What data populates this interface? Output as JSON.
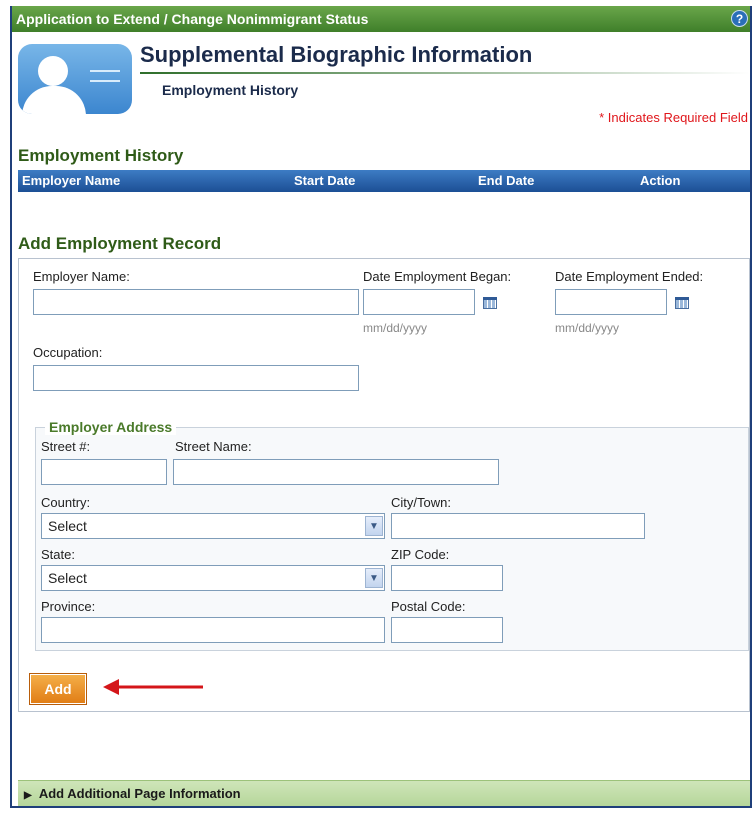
{
  "titlebar": {
    "title": "Application to Extend / Change Nonimmigrant Status",
    "help_glyph": "?"
  },
  "header": {
    "title": "Supplemental Biographic Information",
    "subtitle": "Employment History",
    "required_note": "* Indicates Required Field"
  },
  "history": {
    "heading": "Employment History",
    "columns": [
      "Employer Name",
      "Start Date",
      "End Date",
      "Action"
    ]
  },
  "add_record": {
    "heading": "Add Employment Record",
    "employer_name_label": "Employer Name:",
    "employer_name_value": "",
    "date_began_label": "Date Employment Began:",
    "date_began_value": "",
    "date_began_hint": "mm/dd/yyyy",
    "date_ended_label": "Date Employment Ended:",
    "date_ended_value": "",
    "date_ended_hint": "mm/dd/yyyy",
    "occupation_label": "Occupation:",
    "occupation_value": ""
  },
  "address": {
    "legend": "Employer Address",
    "street_num_label": "Street #:",
    "street_name_label": "Street Name:",
    "country_label": "Country:",
    "country_value": "Select",
    "city_label": "City/Town:",
    "state_label": "State:",
    "state_value": "Select",
    "zip_label": "ZIP Code:",
    "province_label": "Province:",
    "postal_label": "Postal Code:"
  },
  "buttons": {
    "add_label": "Add"
  },
  "footer": {
    "expander_label": "Add Additional Page Information"
  },
  "colors": {
    "accent_green": "#3f7f2a",
    "header_blue": "#1c4f95",
    "required_red": "#e0161b",
    "button_orange": "#e07c14",
    "arrow_red": "#d4161a"
  },
  "icons": [
    "help-icon",
    "person-card-icon",
    "calendar-icon",
    "dropdown-arrow-icon",
    "expand-triangle-icon"
  ]
}
